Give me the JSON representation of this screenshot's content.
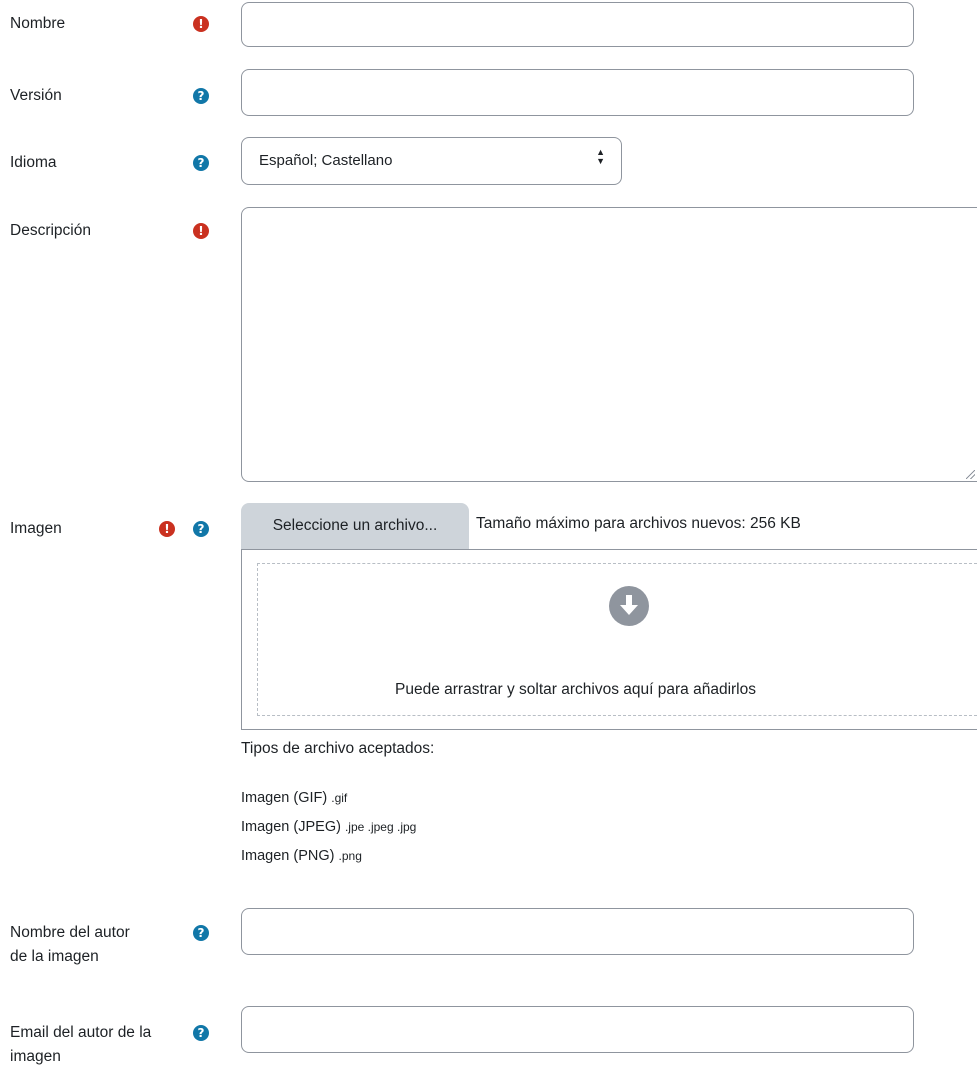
{
  "fields": {
    "nombre": {
      "label": "Nombre",
      "value": ""
    },
    "version": {
      "label": "Versión",
      "value": ""
    },
    "idioma": {
      "label": "Idioma",
      "selected": "Español; Castellano"
    },
    "descripcion": {
      "label": "Descripción",
      "value": ""
    },
    "imagen": {
      "label": "Imagen",
      "button_label": "Seleccione un archivo...",
      "max_size": "Tamaño máximo para archivos nuevos: 256 KB",
      "dropzone_text": "Puede arrastrar y soltar archivos aquí para añadirlos",
      "accepted_title": "Tipos de archivo aceptados:",
      "types": [
        {
          "name": "Imagen (GIF)",
          "ext": ".gif"
        },
        {
          "name": "Imagen (JPEG)",
          "ext": ".jpe .jpeg .jpg"
        },
        {
          "name": "Imagen (PNG)",
          "ext": ".png"
        }
      ]
    },
    "autor_nombre": {
      "label_line1": "Nombre del autor",
      "label_line2": "de la imagen",
      "value": ""
    },
    "autor_email": {
      "label_line1": "Email del autor de la",
      "label_line2": "imagen",
      "value": ""
    }
  },
  "icons": {
    "required": "exclamation-circle-icon",
    "help": "question-circle-icon",
    "upload": "arrow-circle-down-icon"
  },
  "colors": {
    "required": "#ca3120",
    "help": "#1177a8",
    "button_bg": "#ced4da",
    "border": "#8f959e"
  }
}
